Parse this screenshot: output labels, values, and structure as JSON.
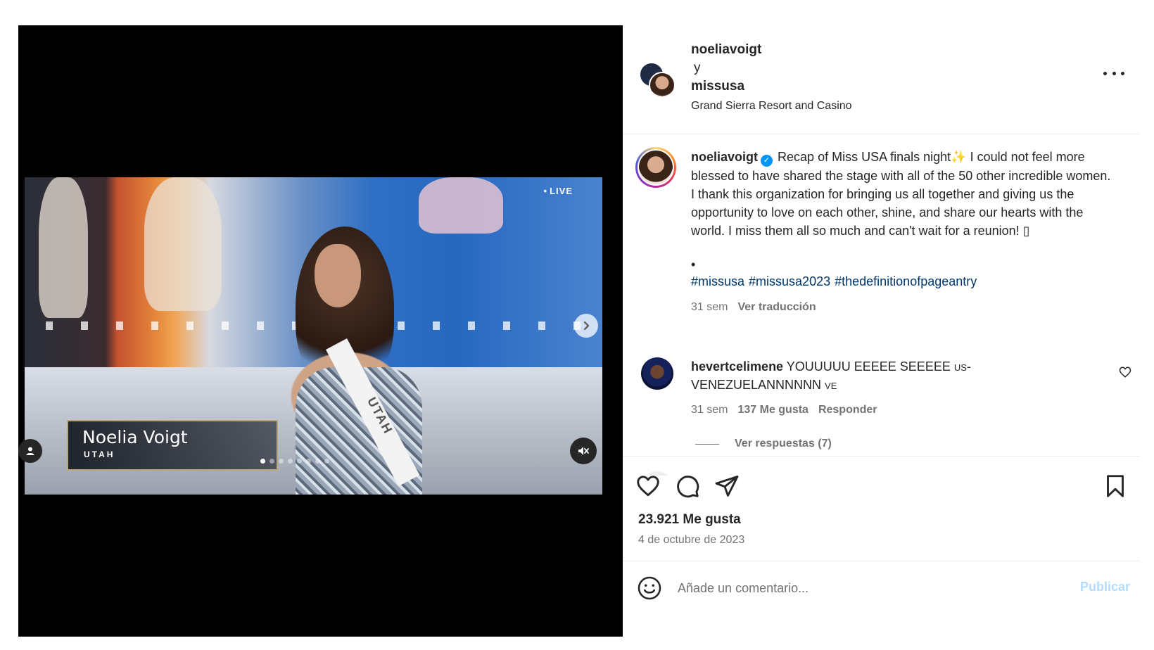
{
  "media": {
    "live_label": "LIVE",
    "lower_third_name": "Noelia Voigt",
    "lower_third_state": "UTAH",
    "sash_text": "UTAH",
    "carousel_dots": 8,
    "carousel_active_index": 0
  },
  "header": {
    "username1": "noeliavoigt",
    "conjunction": "y",
    "username2": "missusa",
    "location": "Grand Sierra Resort and Casino"
  },
  "caption": {
    "username": "noeliavoigt",
    "text_part1": "Recap of Miss USA finals night",
    "emoji": "✨",
    "text_part2": " I could not feel more blessed to have shared the stage with all of the 50 other incredible women. I thank this organization for bringing us all together and giving us the opportunity to love on each other, shine, and share our hearts with the world. I miss them all so much and can't wait for a reunion! ",
    "trailing_box": "▯",
    "bullet": "•",
    "hashtags": [
      "#missusa",
      "#missusa2023",
      "#thedefinitionofpageantry"
    ],
    "time_ago": "31 sem",
    "translate_label": "Ver traducción"
  },
  "comment": {
    "username": "hevertcelimene",
    "text1": "YOUUUUU EEEEE SEEEEE",
    "small1": "US",
    "text2": "-VENEZUELANNNNNN",
    "small2": "VE",
    "time_ago": "31 sem",
    "likes": "137 Me gusta",
    "reply_label": "Responder",
    "view_replies": "Ver respuestas (7)"
  },
  "actions": {
    "likes_count": "23.921 Me gusta",
    "date": "4 de octubre de 2023"
  },
  "comment_box": {
    "placeholder": "Añade un comentario...",
    "publish_label": "Publicar"
  }
}
